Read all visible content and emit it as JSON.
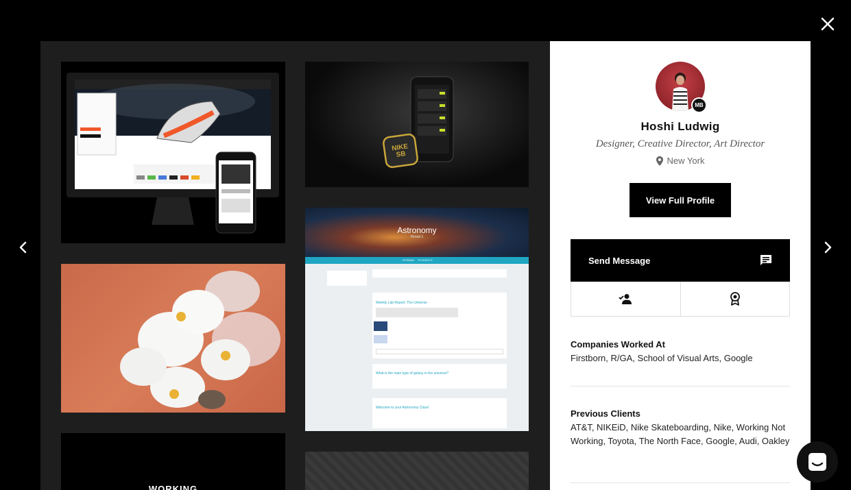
{
  "profile": {
    "name": "Hoshi Ludwig",
    "roles": "Designer, Creative Director, Art Director",
    "location": "New York",
    "avatar_badge": "MB",
    "view_profile_label": "View Full Profile",
    "send_message_label": "Send Message"
  },
  "sections": {
    "companies_title": "Companies Worked At",
    "companies_value": "Firstborn, R/GA, School of Visual Arts, Google",
    "clients_title": "Previous Clients",
    "clients_value": "AT&T, NIKEiD, Nike Skateboarding, Nike, Working Not Working, Toyota, The North Face, Google, Audi, Oakley"
  },
  "gallery": {
    "astronomy_title": "Astronomy",
    "astronomy_subtitle": "Period 1",
    "astronomy_tab_stream": "STREAM",
    "astronomy_tab_students": "STUDENTS",
    "astronomy_assignment_title": "Weekly Lab Report: The Universe",
    "astronomy_question": "What is the main type of galaxy in the universe?",
    "astronomy_announcement": "Welcome to your Astronomy Class!",
    "nike_sb_logo": "NIKE SB",
    "working_text": "WORKING"
  },
  "colors": {
    "overlay": "#000000",
    "panel": "#ffffff",
    "accent_teal": "#1fa6c2",
    "nike_orange": "#f0582a"
  },
  "icons": [
    "close-icon",
    "arrow-left-icon",
    "arrow-right-icon",
    "location-pin-icon",
    "message-icon",
    "follow-user-icon",
    "award-icon",
    "chat-icon"
  ]
}
